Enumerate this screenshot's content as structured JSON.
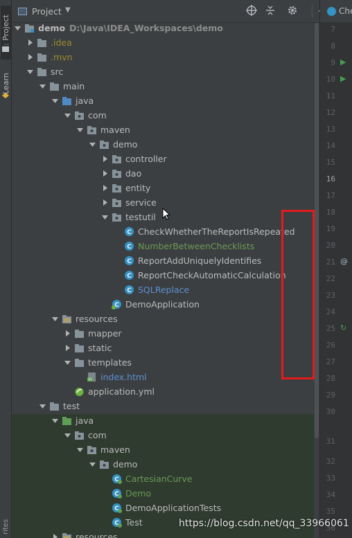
{
  "toolstrip": {
    "project_tab": "1: Project",
    "learn_tab": "Learn",
    "bottom_tab": "rites"
  },
  "header": {
    "title": "Project",
    "buttons": [
      "locate-icon",
      "collapse-icon",
      "gear-icon",
      "minimize-icon"
    ]
  },
  "tree": {
    "root": {
      "name": "demo",
      "path": "D:\\Java\\IDEA_Workspaces\\demo"
    },
    "items": [
      {
        "label": ".idea"
      },
      {
        "label": ".mvn"
      },
      {
        "label": "src"
      },
      {
        "label": "main"
      },
      {
        "label": "java"
      },
      {
        "label": "com"
      },
      {
        "label": "maven"
      },
      {
        "label": "demo"
      },
      {
        "label": "controller"
      },
      {
        "label": "dao"
      },
      {
        "label": "entity"
      },
      {
        "label": "service"
      },
      {
        "label": "testutil"
      },
      {
        "label": "CheckWhetherTheReportIsRepeated"
      },
      {
        "label": "NumberBetweenChecklists"
      },
      {
        "label": "ReportAddUniquelyIdentifies"
      },
      {
        "label": "ReportCheckAutomaticCalculation"
      },
      {
        "label": "SQLReplace"
      },
      {
        "label": "DemoApplication"
      },
      {
        "label": "resources"
      },
      {
        "label": "mapper"
      },
      {
        "label": "static"
      },
      {
        "label": "templates"
      },
      {
        "label": "index.html"
      },
      {
        "label": "application.yml"
      },
      {
        "label": "test"
      },
      {
        "label": "java"
      },
      {
        "label": "com"
      },
      {
        "label": "maven"
      },
      {
        "label": "demo"
      },
      {
        "label": "CartesianCurve"
      },
      {
        "label": "Demo"
      },
      {
        "label": "DemoApplicationTests"
      },
      {
        "label": "Test"
      },
      {
        "label": "resources"
      }
    ]
  },
  "editor": {
    "tab_label": "Che",
    "line_numbers": [
      "7",
      "8",
      "9",
      "10",
      "11",
      "12",
      "13",
      "14",
      "15",
      "16",
      "17",
      "18",
      "19",
      "20",
      "21",
      "22",
      "23",
      "24",
      "25",
      "26",
      "27",
      "28",
      "29",
      "30",
      "31",
      "32",
      "33",
      "34",
      "35",
      "36"
    ],
    "active_line": "16"
  },
  "watermark": "https://blog.csdn.net/qq_33966061",
  "colors": {
    "background": "#3c3f41",
    "gutter": "#313335",
    "highlight_box": "#e21b1b",
    "test_band": "#2f3b2f"
  }
}
